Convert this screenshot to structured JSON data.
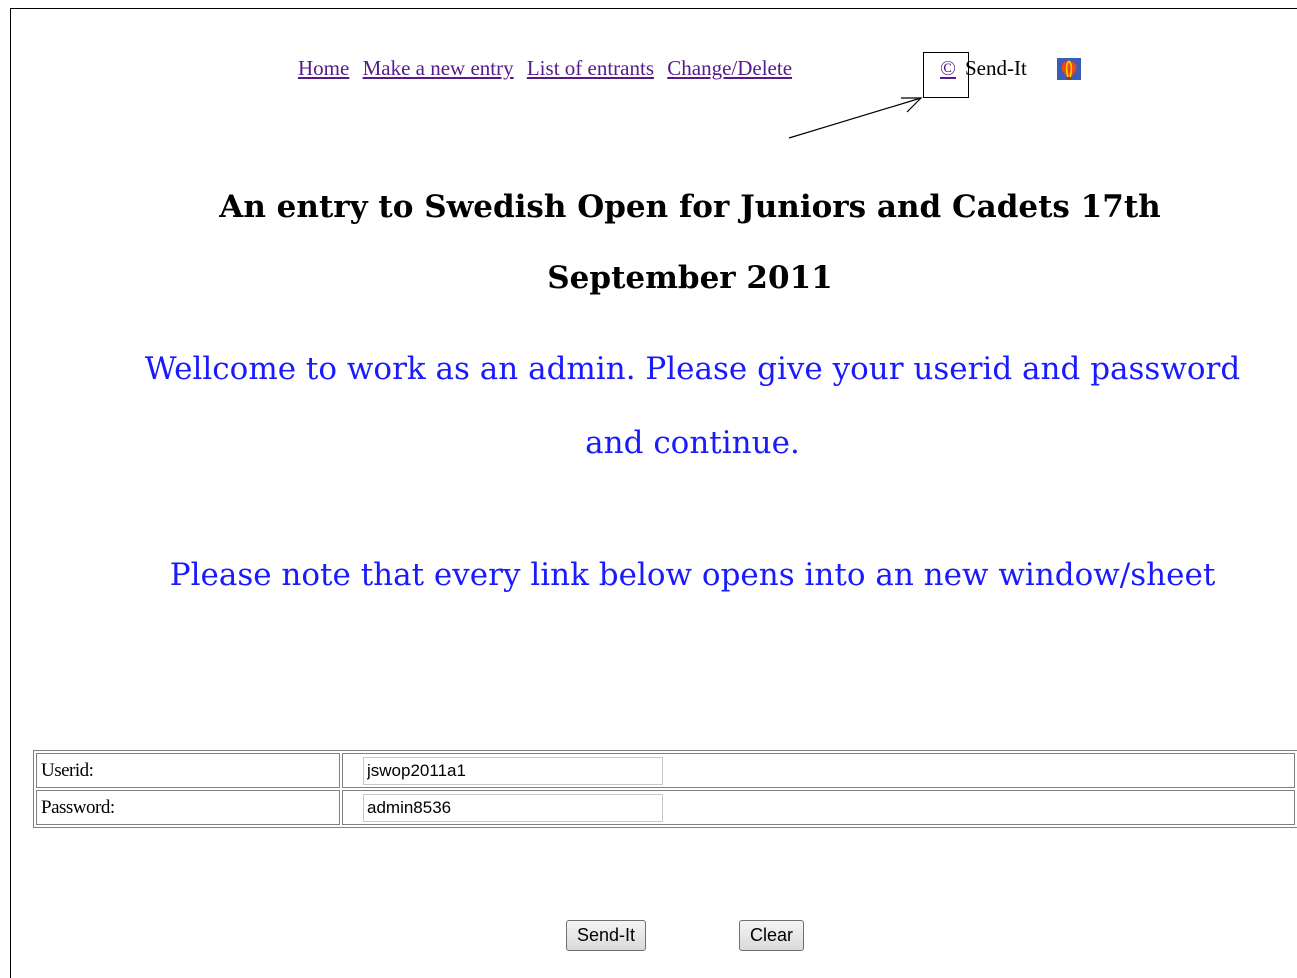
{
  "nav": {
    "links": [
      "Home",
      "Make a new entry",
      "List of entrants",
      "Change/Delete"
    ],
    "copyright_symbol": "©",
    "sendit_label": "Send-It",
    "sendit_icon": "balloon-logo-icon",
    "arrow_icon": "annotation-arrow-icon"
  },
  "page": {
    "title_line1": "An entry to Swedish Open for Juniors and Cadets 17th",
    "title_line2": "September 2011",
    "welcome_line1": "Wellcome to work as an admin. Please give your userid and password",
    "welcome_line2": "and continue.",
    "note": "Please note that every link below opens into an new window/sheet"
  },
  "form": {
    "userid_label": "Userid:",
    "userid_value": "jswop2011a1",
    "password_label": "Password:",
    "password_value": "admin8536",
    "submit_label": "Send-It",
    "clear_label": "Clear"
  },
  "colors": {
    "link": "#551a8b",
    "welcome_text": "#1a1aff"
  }
}
